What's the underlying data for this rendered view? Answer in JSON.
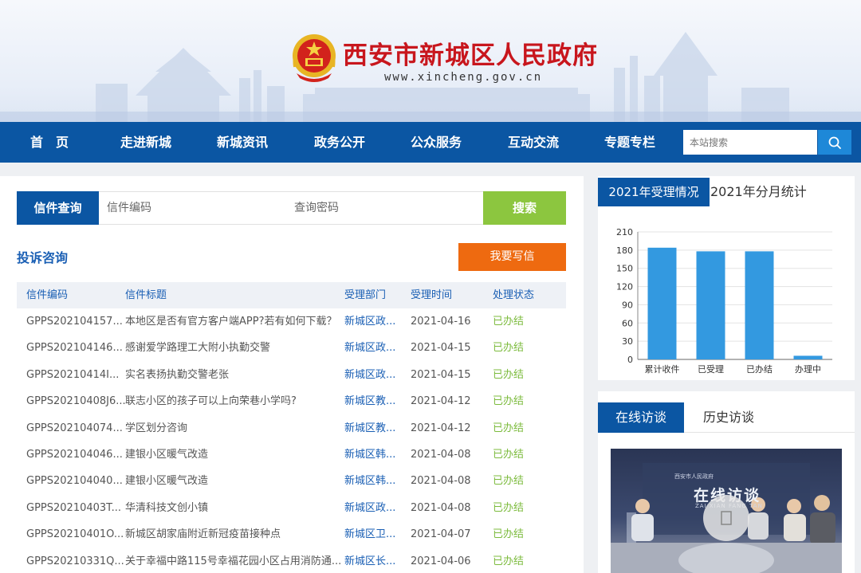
{
  "header": {
    "title": "西安市新城区人民政府",
    "url": "www.xincheng.gov.cn"
  },
  "nav": {
    "items": [
      "首　页",
      "走进新城",
      "新城资讯",
      "政务公开",
      "公众服务",
      "互动交流",
      "专题专栏"
    ],
    "search_placeholder": "本站搜索"
  },
  "query": {
    "label": "信件查询",
    "code_placeholder": "信件编码",
    "password_placeholder": "查询密码",
    "button": "搜索"
  },
  "complaints": {
    "title": "投诉咨询",
    "write_button": "我要写信",
    "headers": [
      "信件编码",
      "信件标题",
      "受理部门",
      "受理时间",
      "处理状态"
    ],
    "rows": [
      {
        "code": "GPPS202104157...",
        "title": "本地区是否有官方客户端APP?若有如何下载？",
        "dept": "新城区政...",
        "date": "2021-04-16",
        "status": "已办结"
      },
      {
        "code": "GPPS202104146...",
        "title": "感谢爱学路理工大附小执勤交警",
        "dept": "新城区政...",
        "date": "2021-04-15",
        "status": "已办结"
      },
      {
        "code": "GPPS20210414I...",
        "title": "实名表扬执勤交警老张",
        "dept": "新城区政...",
        "date": "2021-04-15",
        "status": "已办结"
      },
      {
        "code": "GPPS20210408J6...",
        "title": "联志小区的孩子可以上向荣巷小学吗?",
        "dept": "新城区教...",
        "date": "2021-04-12",
        "status": "已办结"
      },
      {
        "code": "GPPS202104074...",
        "title": "学区划分咨询",
        "dept": "新城区教...",
        "date": "2021-04-12",
        "status": "已办结"
      },
      {
        "code": "GPPS202104046...",
        "title": "建银小区暖气改造",
        "dept": "新城区韩...",
        "date": "2021-04-08",
        "status": "已办结"
      },
      {
        "code": "GPPS202104040...",
        "title": "建银小区暖气改造",
        "dept": "新城区韩...",
        "date": "2021-04-08",
        "status": "已办结"
      },
      {
        "code": "GPPS20210403T...",
        "title": "华清科技文创小镇",
        "dept": "新城区政...",
        "date": "2021-04-08",
        "status": "已办结"
      },
      {
        "code": "GPPS20210401O...",
        "title": "新城区胡家庙附近新冠疫苗接种点",
        "dept": "新城区卫...",
        "date": "2021-04-07",
        "status": "已办结"
      },
      {
        "code": "GPPS20210331Q...",
        "title": "关于幸福中路115号幸福花园小区占用消防通...",
        "dept": "新城区长...",
        "date": "2021-04-06",
        "status": "已办结"
      }
    ]
  },
  "stats": {
    "tab": "2021年受理情况",
    "subtitle": "2021年分月统计"
  },
  "chart_data": {
    "type": "bar",
    "categories": [
      "累计收件",
      "已受理",
      "已办结",
      "办理中"
    ],
    "values": [
      184,
      178,
      178,
      6
    ],
    "ylim": [
      0,
      210
    ],
    "yticks": [
      0,
      30,
      60,
      90,
      120,
      150,
      180,
      210
    ],
    "bar_color": "#3399e0",
    "grid": true
  },
  "visits": {
    "active_tab": "在线访谈",
    "other_tab": "历史访谈",
    "video_banner": "在线访谈",
    "video_banner_sub": "ZAI XIAN FANG TAN",
    "video_org": "西安市人民政府"
  },
  "colors": {
    "nav_bg": "#0b56a3",
    "title_red": "#c8161d",
    "search_green": "#8cc63f",
    "write_orange": "#ee6a10",
    "status_green": "#7cbb3d"
  }
}
